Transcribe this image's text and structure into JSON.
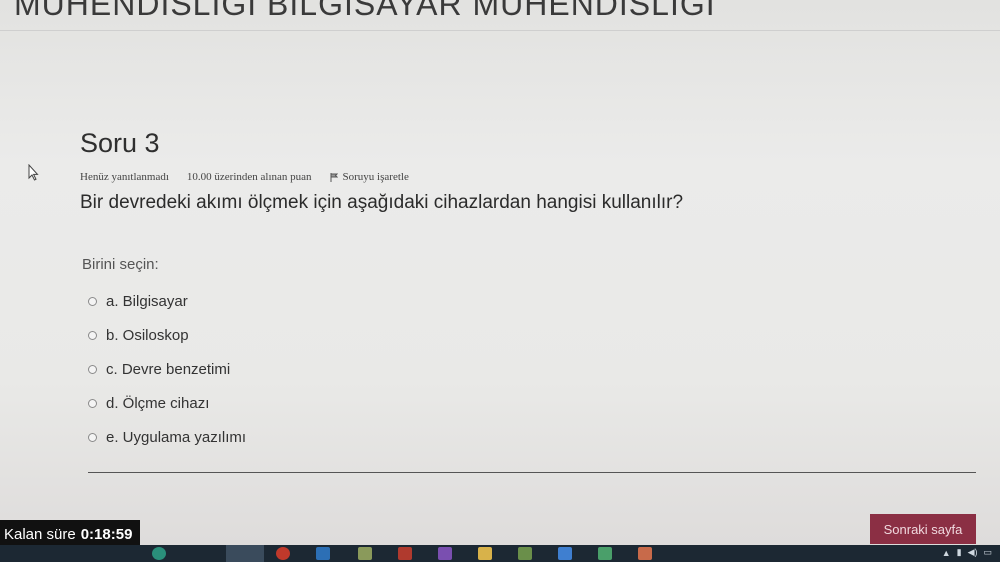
{
  "header": {
    "title": "MÜHENDISLIGI BILGISAYAR MÜHENDISLIGI"
  },
  "question": {
    "title": "Soru 3",
    "status": "Henüz yanıtlanmadı",
    "points": "10.00 üzerinden alınan puan",
    "flag_label": "Soruyu işaretle",
    "text": "Bir devredeki akımı ölçmek için aşağıdaki cihazlardan hangisi kullanılır?"
  },
  "answers": {
    "prompt": "Birini seçin:",
    "options": [
      {
        "label": "a. Bilgisayar"
      },
      {
        "label": "b. Osiloskop"
      },
      {
        "label": "c. Devre benzetimi"
      },
      {
        "label": "d. Ölçme cihazı"
      },
      {
        "label": "e. Uygulama yazılımı"
      }
    ]
  },
  "timer": {
    "label": "Kalan süre",
    "value": "0:18:59"
  },
  "navigation": {
    "next_label": "Sonraki sayfa"
  },
  "colors": {
    "next_button": "#8b2f44",
    "timer_bg": "#111111",
    "taskbar": "#1c2833"
  }
}
